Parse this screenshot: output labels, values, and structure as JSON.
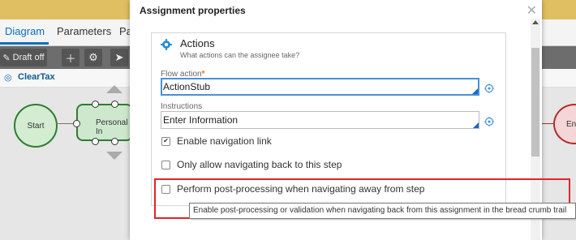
{
  "background": {
    "tabs": [
      "Diagram",
      "Parameters",
      "Pa"
    ],
    "toolbar": {
      "draft_label": "Draft off",
      "plus_icon": "plus-icon",
      "gear_icon": "gear-icon"
    },
    "breadcrumb": "ClearTax",
    "nodes": {
      "start": "Start",
      "task": "Personal In",
      "end": "End"
    }
  },
  "modal": {
    "title": "Assignment properties",
    "section": {
      "title": "Actions",
      "subtitle": "What actions can the assignee take?"
    },
    "flow_action": {
      "label": "Flow action",
      "required_mark": "*",
      "value": "ActionStub"
    },
    "instructions": {
      "label": "Instructions",
      "value": "Enter Information"
    },
    "checkboxes": [
      {
        "label": "Enable navigation link",
        "checked": true
      },
      {
        "label": "Only allow navigating back to this step",
        "checked": false
      },
      {
        "label": "Perform post-processing when navigating away from step",
        "checked": false
      }
    ],
    "tooltip": "Enable post-processing or validation when navigating back from this assignment in the bread crumb trail",
    "colors": {
      "accent": "#1b66c9",
      "highlight": "#e0252b",
      "required": "#e07b00"
    }
  }
}
